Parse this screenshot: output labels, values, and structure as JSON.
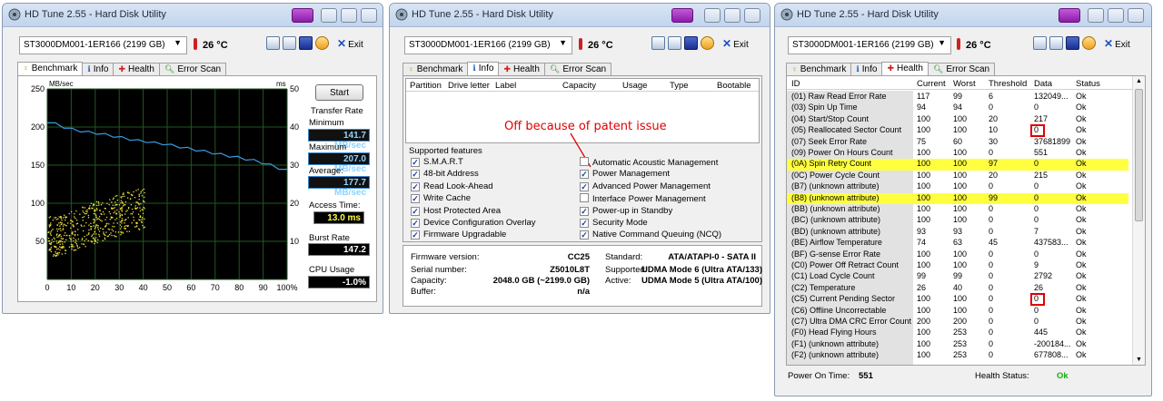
{
  "app": {
    "title": "HD Tune 2.55 - Hard Disk Utility",
    "drive": "ST3000DM001-1ER166 (2199 GB)",
    "temperature": "26 °C",
    "exit_label": "Exit"
  },
  "tabs": [
    "Benchmark",
    "Info",
    "Health",
    "Error Scan"
  ],
  "benchmark": {
    "y_unit": "MB/sec",
    "y2_unit": "ms",
    "y_ticks": [
      "250",
      "200",
      "150",
      "100",
      "50"
    ],
    "y2_ticks": [
      "50",
      "40",
      "30",
      "20",
      "10"
    ],
    "x_ticks": [
      "0",
      "10",
      "20",
      "30",
      "40",
      "50",
      "60",
      "70",
      "80",
      "90",
      "100%"
    ],
    "start_label": "Start",
    "transfer_rate_title": "Transfer Rate",
    "minimum_label": "Minimum",
    "minimum_value": "141.7 MB/sec",
    "maximum_label": "Maximum",
    "maximum_value": "207.0 MB/sec",
    "average_label": "Average:",
    "average_value": "177.7 MB/sec",
    "access_label": "Access Time:",
    "access_value": "13.0 ms",
    "burst_label": "Burst Rate",
    "burst_value": "147.2 MB/sec",
    "cpu_label": "CPU Usage",
    "cpu_value": "-1.0%"
  },
  "chart_data": {
    "type": "line",
    "title": "",
    "xlabel": "",
    "ylabel": "MB/sec",
    "xlim": [
      0,
      100
    ],
    "ylim": [
      0,
      250
    ],
    "y2lim": [
      0,
      50
    ],
    "series": [
      {
        "values": [
          207,
          204,
          200,
          197,
          195,
          193,
          192,
          190,
          188,
          186,
          184,
          182,
          181,
          179,
          178,
          176,
          174,
          172,
          170,
          168,
          166,
          164,
          162,
          160,
          158,
          156,
          153,
          150,
          146,
          143
        ]
      }
    ]
  },
  "info": {
    "columns": [
      "Partition",
      "Drive letter",
      "Label",
      "Capacity",
      "Usage",
      "Type",
      "Bootable"
    ],
    "annotation": "Off because of patent issue",
    "features_title": "Supported features",
    "features_left": [
      {
        "label": "S.M.A.R.T",
        "checked": true
      },
      {
        "label": "48-bit Address",
        "checked": true
      },
      {
        "label": "Read Look-Ahead",
        "checked": true
      },
      {
        "label": "Write Cache",
        "checked": true
      },
      {
        "label": "Host Protected Area",
        "checked": true
      },
      {
        "label": "Device Configuration Overlay",
        "checked": true
      },
      {
        "label": "Firmware Upgradable",
        "checked": true
      }
    ],
    "features_right": [
      {
        "label": "Automatic Acoustic Management",
        "checked": false
      },
      {
        "label": "Power Management",
        "checked": true
      },
      {
        "label": "Advanced Power Management",
        "checked": true
      },
      {
        "label": "Interface Power Management",
        "checked": false
      },
      {
        "label": "Power-up in Standby",
        "checked": true
      },
      {
        "label": "Security Mode",
        "checked": true
      },
      {
        "label": "Native Command Queuing (NCQ)",
        "checked": true
      }
    ],
    "firmware_label": "Firmware version:",
    "firmware_value": "CC25",
    "serial_label": "Serial number:",
    "serial_value": "Z5010L8T",
    "capacity_label": "Capacity:",
    "capacity_value": "2048.0 GB (~2199.0 GB)",
    "buffer_label": "Buffer:",
    "buffer_value": "n/a",
    "standard_label": "Standard:",
    "standard_value": "ATA/ATAPI-0 - SATA II",
    "supported_label": "Supported:",
    "supported_value": "UDMA Mode 6 (Ultra ATA/133)",
    "active_label": "Active:",
    "active_value": "UDMA Mode 5 (Ultra ATA/100)"
  },
  "health": {
    "columns": [
      "ID",
      "Current",
      "Worst",
      "Threshold",
      "Data",
      "Status"
    ],
    "rows": [
      [
        "(01) Raw Read Error Rate",
        "117",
        "99",
        "6",
        "132049...",
        "Ok"
      ],
      [
        "(03) Spin Up Time",
        "94",
        "94",
        "0",
        "0",
        "Ok"
      ],
      [
        "(04) Start/Stop Count",
        "100",
        "100",
        "20",
        "217",
        "Ok"
      ],
      [
        "(05) Reallocated Sector Count",
        "100",
        "100",
        "10",
        "0",
        "Ok"
      ],
      [
        "(07) Seek Error Rate",
        "75",
        "60",
        "30",
        "37681899",
        "Ok"
      ],
      [
        "(09) Power On Hours Count",
        "100",
        "100",
        "0",
        "551",
        "Ok"
      ],
      [
        "(0A) Spin Retry Count",
        "100",
        "100",
        "97",
        "0",
        "Ok"
      ],
      [
        "(0C) Power Cycle Count",
        "100",
        "100",
        "20",
        "215",
        "Ok"
      ],
      [
        "(B7) (unknown attribute)",
        "100",
        "100",
        "0",
        "0",
        "Ok"
      ],
      [
        "(B8) (unknown attribute)",
        "100",
        "100",
        "99",
        "0",
        "Ok"
      ],
      [
        "(BB) (unknown attribute)",
        "100",
        "100",
        "0",
        "0",
        "Ok"
      ],
      [
        "(BC) (unknown attribute)",
        "100",
        "100",
        "0",
        "0",
        "Ok"
      ],
      [
        "(BD) (unknown attribute)",
        "93",
        "93",
        "0",
        "7",
        "Ok"
      ],
      [
        "(BE) Airflow Temperature",
        "74",
        "63",
        "45",
        "437583...",
        "Ok"
      ],
      [
        "(BF) G-sense Error Rate",
        "100",
        "100",
        "0",
        "0",
        "Ok"
      ],
      [
        "(C0) Power Off Retract Count",
        "100",
        "100",
        "0",
        "9",
        "Ok"
      ],
      [
        "(C1) Load Cycle Count",
        "99",
        "99",
        "0",
        "2792",
        "Ok"
      ],
      [
        "(C2) Temperature",
        "26",
        "40",
        "0",
        "26",
        "Ok"
      ],
      [
        "(C5) Current Pending Sector",
        "100",
        "100",
        "0",
        "0",
        "Ok"
      ],
      [
        "(C6) Offline Uncorrectable",
        "100",
        "100",
        "0",
        "0",
        "Ok"
      ],
      [
        "(C7) Ultra DMA CRC Error Count",
        "200",
        "200",
        "0",
        "0",
        "Ok"
      ],
      [
        "(F0) Head Flying Hours",
        "100",
        "253",
        "0",
        "445",
        "Ok"
      ],
      [
        "(F1) (unknown attribute)",
        "100",
        "253",
        "0",
        "-200184...",
        "Ok"
      ],
      [
        "(F2) (unknown attribute)",
        "100",
        "253",
        "0",
        "677808...",
        "Ok"
      ]
    ],
    "highlighted": [
      6,
      9
    ],
    "boxed": [
      3,
      18
    ],
    "power_on_label": "Power On Time:",
    "power_on_value": "551",
    "health_status_label": "Health Status:",
    "health_status_value": "Ok"
  },
  "colors": {
    "highlight": "#ffff40",
    "annotation": "#e00000",
    "chart_bg": "#000000",
    "transfer_line": "#3a9ae0",
    "access_points": "#f0e040"
  }
}
